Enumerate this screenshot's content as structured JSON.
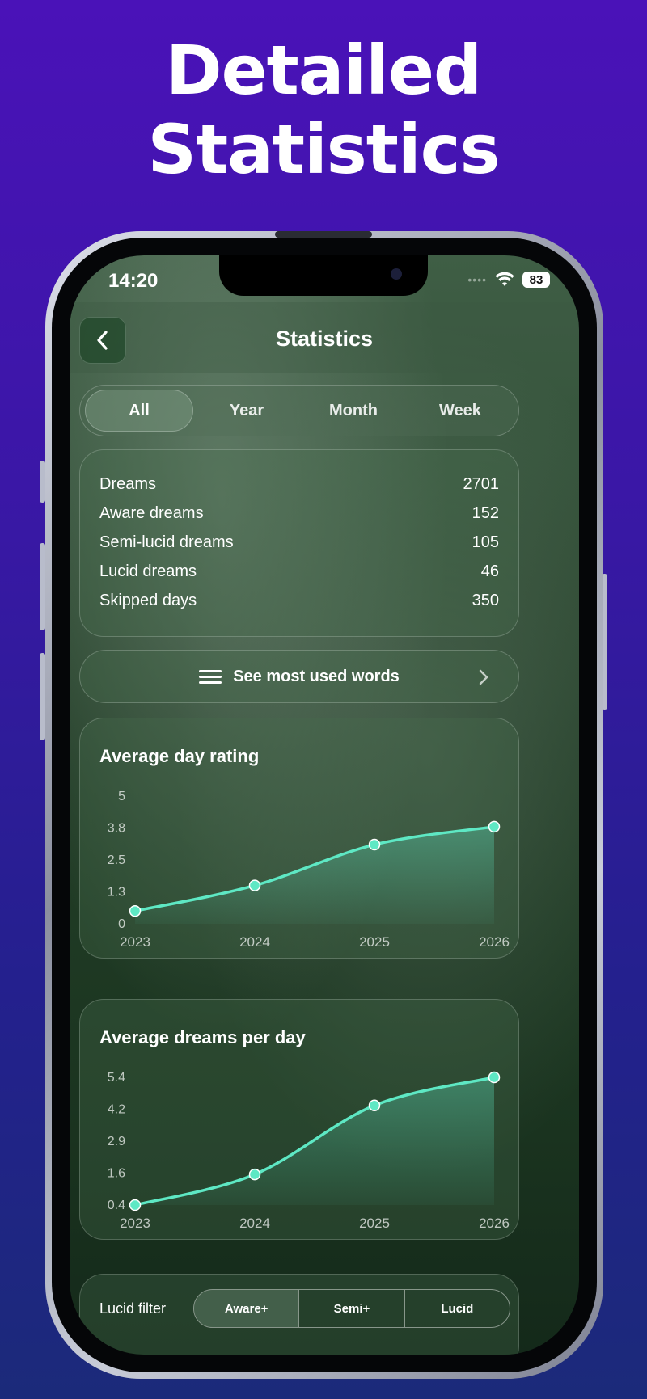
{
  "headline": {
    "line1": "Detailed",
    "line2": "Statistics"
  },
  "status_bar": {
    "time": "14:20",
    "battery": "83",
    "signal_dots": "••••"
  },
  "nav": {
    "title": "Statistics",
    "back_icon": "chevron-left-icon"
  },
  "period_tabs": [
    {
      "label": "All",
      "active": true
    },
    {
      "label": "Year",
      "active": false
    },
    {
      "label": "Month",
      "active": false
    },
    {
      "label": "Week",
      "active": false
    }
  ],
  "stats": [
    {
      "label": "Dreams",
      "value": "2701"
    },
    {
      "label": "Aware dreams",
      "value": "152"
    },
    {
      "label": "Semi-lucid dreams",
      "value": "105"
    },
    {
      "label": "Lucid dreams",
      "value": "46"
    },
    {
      "label": "Skipped days",
      "value": "350"
    }
  ],
  "words_button": {
    "label": "See most used words"
  },
  "colors": {
    "accent": "#5ee8c4",
    "background_top": "#4a12b8",
    "background_bottom": "#1b2a7a"
  },
  "chart_data": [
    {
      "type": "area",
      "title": "Average day rating",
      "x": [
        "2023",
        "2024",
        "2025",
        "2026"
      ],
      "values": [
        0.5,
        1.5,
        3.1,
        3.8
      ],
      "yticks": [
        "5",
        "3.8",
        "2.5",
        "1.3",
        "0"
      ],
      "ylim": [
        0,
        5
      ],
      "grid": false
    },
    {
      "type": "area",
      "title": "Average dreams per day",
      "x": [
        "2023",
        "2024",
        "2025",
        "2026"
      ],
      "values": [
        0.4,
        1.6,
        4.3,
        5.4
      ],
      "yticks": [
        "5.4",
        "4.2",
        "2.9",
        "1.6",
        "0.4"
      ],
      "ylim": [
        0.4,
        5.4
      ],
      "grid": false
    }
  ],
  "lucid_filter": {
    "label": "Lucid filter",
    "options": [
      {
        "label": "Aware+",
        "active": true
      },
      {
        "label": "Semi+",
        "active": false
      },
      {
        "label": "Lucid",
        "active": false
      }
    ]
  }
}
